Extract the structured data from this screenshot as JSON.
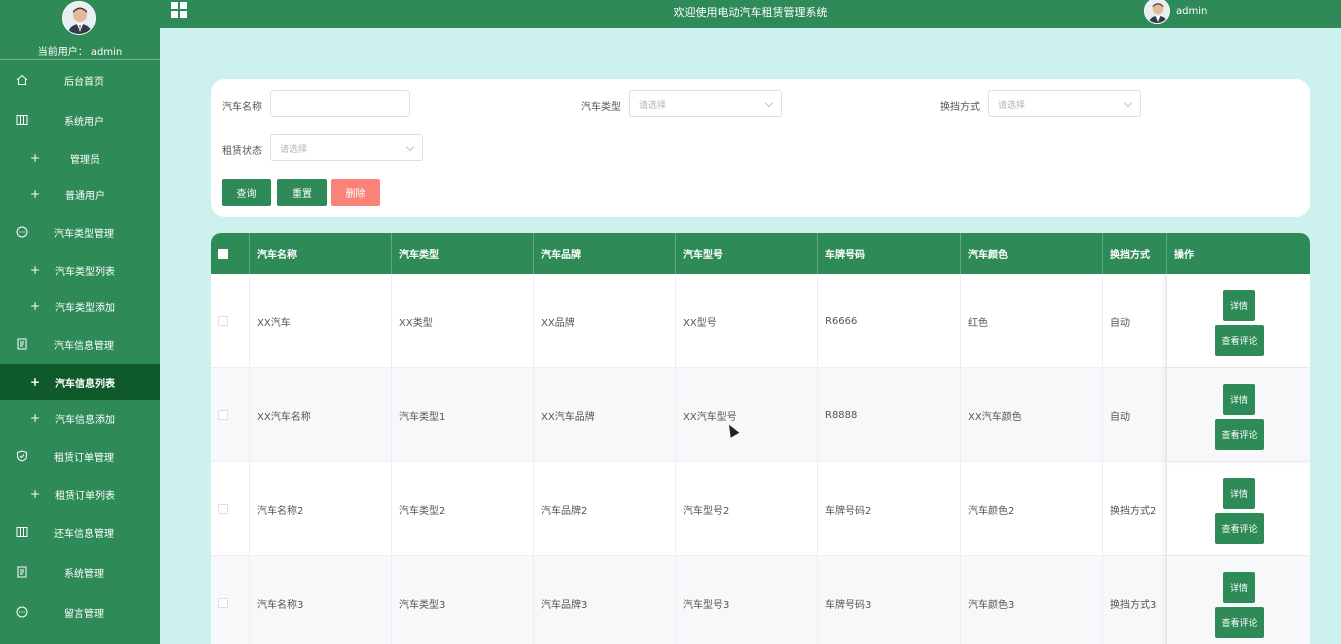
{
  "header": {
    "title": "欢迎使用电动汽车租赁管理系统",
    "user": "admin"
  },
  "sidebar": {
    "current_user": "当前用户： admin",
    "items": [
      {
        "label": "后台首页",
        "type": "top",
        "icon": "home-icon"
      },
      {
        "label": "系统用户",
        "type": "top",
        "icon": "columns-icon"
      },
      {
        "label": "管理员",
        "type": "sub"
      },
      {
        "label": "普通用户",
        "type": "sub"
      },
      {
        "label": "汽车类型管理",
        "type": "top",
        "icon": "chat-icon"
      },
      {
        "label": "汽车类型列表",
        "type": "sub"
      },
      {
        "label": "汽车类型添加",
        "type": "sub"
      },
      {
        "label": "汽车信息管理",
        "type": "top",
        "icon": "document-icon"
      },
      {
        "label": "汽车信息列表",
        "type": "sub",
        "active": true
      },
      {
        "label": "汽车信息添加",
        "type": "sub"
      },
      {
        "label": "租赁订单管理",
        "type": "top",
        "icon": "shield-icon"
      },
      {
        "label": "租赁订单列表",
        "type": "sub"
      },
      {
        "label": "还车信息管理",
        "type": "top",
        "icon": "columns-icon"
      },
      {
        "label": "系统管理",
        "type": "top",
        "icon": "document-icon"
      },
      {
        "label": "留言管理",
        "type": "top",
        "icon": "chat-icon"
      }
    ]
  },
  "search": {
    "car_name_label": "汽车名称",
    "car_name_value": "",
    "car_type_label": "汽车类型",
    "gearbox_label": "换挡方式",
    "rent_status_label": "租赁状态",
    "select_placeholder": "请选择",
    "query_btn": "查询",
    "reset_btn": "重置",
    "delete_btn": "删除"
  },
  "table": {
    "headers": [
      "汽车名称",
      "汽车类型",
      "汽车品牌",
      "汽车型号",
      "车牌号码",
      "汽车颜色",
      "换挡方式",
      "操作"
    ],
    "detail_btn": "详情",
    "comment_btn": "查看评论",
    "rows": [
      [
        "XX汽车",
        "XX类型",
        "XX品牌",
        "XX型号",
        "R6666",
        "红色",
        "自动"
      ],
      [
        "XX汽车名称",
        "汽车类型1",
        "XX汽车品牌",
        "XX汽车型号",
        "R8888",
        "XX汽车颜色",
        "自动"
      ],
      [
        "汽车名称2",
        "汽车类型2",
        "汽车品牌2",
        "汽车型号2",
        "车牌号码2",
        "汽车颜色2",
        "换挡方式2"
      ],
      [
        "汽车名称3",
        "汽车类型3",
        "汽车品牌3",
        "汽车型号3",
        "车牌号码3",
        "汽车颜色3",
        "换挡方式3"
      ]
    ]
  },
  "colors": {
    "primary": "#2e8b57",
    "active_nav": "#0f5a2b",
    "danger": "#f98379",
    "background": "#cdf1ef"
  }
}
